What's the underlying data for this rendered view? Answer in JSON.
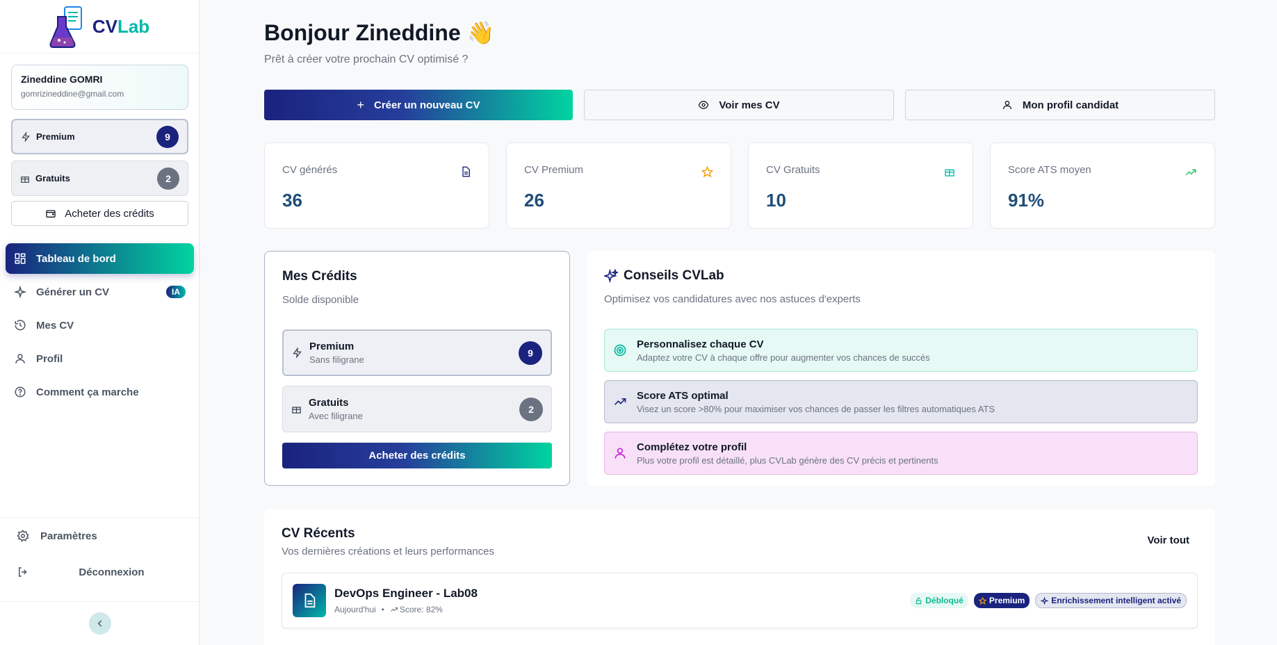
{
  "app": {
    "logo_text_cv": "CV",
    "logo_text_lab": "Lab"
  },
  "user": {
    "name": "Zineddine GOMRI",
    "email": "gomrizineddine@gmail.com"
  },
  "sidebar_credits": {
    "premium_label": "Premium",
    "premium_count": "9",
    "free_label": "Gratuits",
    "free_count": "2",
    "buy_label": "Acheter des crédits"
  },
  "nav": {
    "dashboard": "Tableau de bord",
    "generate": "Générer un CV",
    "generate_badge": "IA",
    "my_cv": "Mes CV",
    "profile": "Profil",
    "how": "Comment ça marche"
  },
  "footer": {
    "settings": "Paramètres",
    "logout": "Déconnexion"
  },
  "header": {
    "greeting": "Bonjour Zineddine 👋",
    "subtitle": "Prêt à créer votre prochain CV optimisé ?"
  },
  "actions": {
    "create": "Créer un nouveau CV",
    "view": "Voir mes CV",
    "profile": "Mon profil candidat"
  },
  "stats": [
    {
      "label": "CV générés",
      "value": "36"
    },
    {
      "label": "CV Premium",
      "value": "26"
    },
    {
      "label": "CV Gratuits",
      "value": "10"
    },
    {
      "label": "Score ATS moyen",
      "value": "91%"
    }
  ],
  "credits_card": {
    "title": "Mes Crédits",
    "subtitle": "Solde disponible",
    "premium_title": "Premium",
    "premium_sub": "Sans filigrane",
    "premium_count": "9",
    "free_title": "Gratuits",
    "free_sub": "Avec filigrane",
    "free_count": "2",
    "buy": "Acheter des crédits"
  },
  "tips": {
    "title": "Conseils CVLab",
    "subtitle": "Optimisez vos candidatures avec nos astuces d'experts",
    "items": [
      {
        "title": "Personnalisez chaque CV",
        "text": "Adaptez votre CV à chaque offre pour augmenter vos chances de succès"
      },
      {
        "title": "Score ATS optimal",
        "text": "Visez un score >80% pour maximiser vos chances de passer les filtres automatiques ATS"
      },
      {
        "title": "Complétez votre profil",
        "text": "Plus votre profil est détaillé, plus CVLab génère des CV précis et pertinents"
      }
    ]
  },
  "recent": {
    "title": "CV Récents",
    "subtitle": "Vos dernières créations et leurs performances",
    "see_all": "Voir tout",
    "items": [
      {
        "title": "DevOps Engineer - Lab08",
        "date": "Aujourd'hui",
        "score": "Score: 82%",
        "badge_unlock": "Débloqué",
        "badge_premium": "Premium",
        "badge_enrich": "Enrichissement intelligent activé"
      }
    ]
  },
  "colors": {
    "navy": "#1a237e",
    "teal": "#00d4a0",
    "stat_value": "#1f4e79"
  }
}
